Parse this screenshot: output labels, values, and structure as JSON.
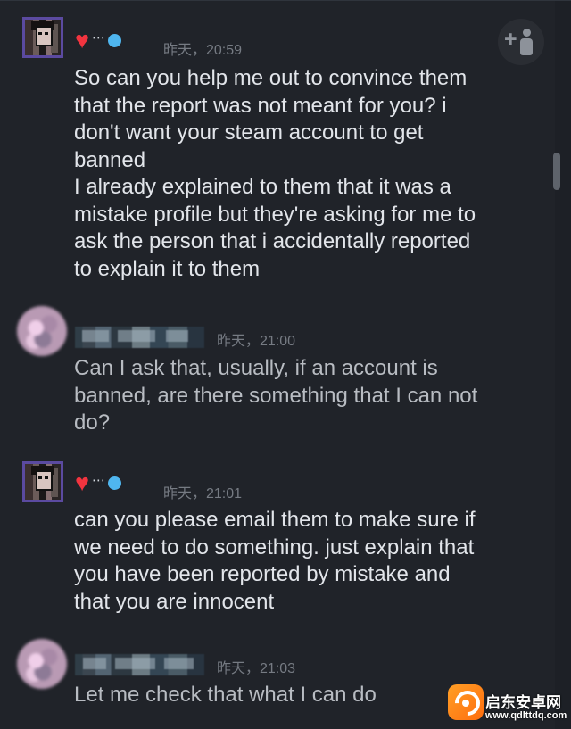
{
  "messages": [
    {
      "sender": "self_styled",
      "timestamp": "昨天，20:59",
      "lines": [
        "So can you help me out to convince them",
        "that the report was not meant for you? i",
        "don't want your steam account to get",
        "banned",
        "I already explained to them that it was a",
        "mistake profile but they're asking for me to",
        "ask the person that i accidentally reported",
        "to explain it to them"
      ]
    },
    {
      "sender": "redacted",
      "timestamp": "昨天，21:00",
      "lines": [
        "Can I ask that, usually, if an account is",
        "banned, are there something that I can not",
        "do?"
      ]
    },
    {
      "sender": "self_styled",
      "timestamp": "昨天，21:01",
      "lines": [
        "can you please email them to make sure if",
        "we need to do something. just explain that",
        "you have been reported by mistake and",
        "that you are innocent"
      ]
    },
    {
      "sender": "redacted",
      "timestamp": "昨天，21:03",
      "lines": [
        "Let me check that what I can do"
      ]
    }
  ],
  "user": {
    "name_symbols": "heart-dots-blue",
    "avatar_icon": "pixel-avatar-icon"
  },
  "toolbar": {
    "add_friend_icon": "add-friend-icon"
  },
  "watermark": {
    "title": "启东安卓网",
    "url": "www.qdlttdq.com"
  },
  "colors": {
    "background": "#202329",
    "text": "#e2e5ea",
    "timestamp": "#767b83",
    "heart": "#f2343f",
    "blue_dot": "#4fb6ef"
  }
}
